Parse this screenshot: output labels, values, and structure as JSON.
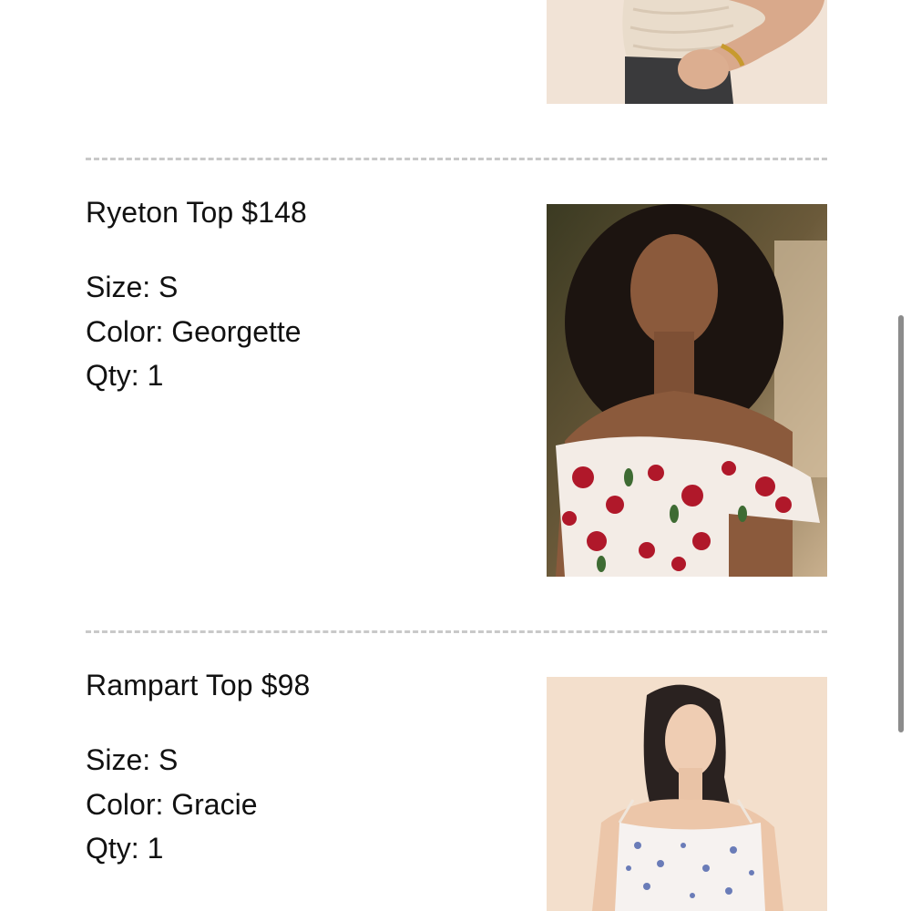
{
  "items": [
    {
      "name": "",
      "price": "",
      "image": "beige-ruched-top-photo"
    },
    {
      "name": "Ryeton Top",
      "price": "$148",
      "size": "Size: S",
      "color": "Color: Georgette",
      "qty": "Qty: 1",
      "image": "floral-off-shoulder-top-photo"
    },
    {
      "name": "Rampart Top",
      "price": "$98",
      "size": "Size: S",
      "color": "Color: Gracie",
      "qty": "Qty: 1",
      "image": "blue-floral-cami-top-photo"
    }
  ],
  "colors": {
    "text": "#111111",
    "divider": "#c9c9c9",
    "scrollbar": "#8c8c8c"
  }
}
